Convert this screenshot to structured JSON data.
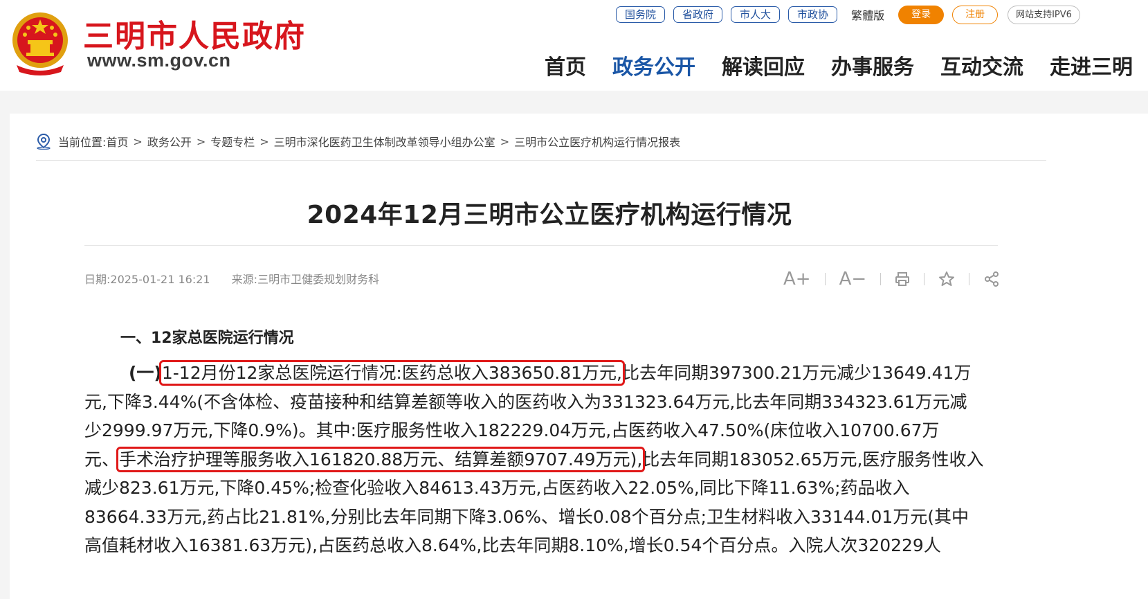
{
  "header": {
    "site_name": "三明市人民政府",
    "site_url": "www.sm.gov.cn",
    "top_links": [
      "国务院",
      "省政府",
      "市人大",
      "市政协"
    ],
    "traditional": "繁體版",
    "login": "登录",
    "register": "注册",
    "ipv6": "网站支持IPV6",
    "nav": [
      "首页",
      "政务公开",
      "解读回应",
      "办事服务",
      "互动交流",
      "走进三明"
    ],
    "nav_active": "政务公开"
  },
  "breadcrumb": {
    "prefix": "当前位置:",
    "items": [
      "首页",
      "政务公开",
      "专题专栏",
      "三明市深化医药卫生体制改革领导小组办公室",
      "三明市公立医疗机构运行情况报表"
    ],
    "separator": ">"
  },
  "article": {
    "title": "2024年12月三明市公立医疗机构运行情况",
    "date_label": "日期:2025-01-21 16:21",
    "source_label": "来源:三明市卫健委规划财务科",
    "tools": {
      "font_increase": "A+",
      "font_decrease": "A−",
      "separator": "|"
    },
    "section_heading": "一、12家总医院运行情况",
    "para_label": "(一)",
    "line1_highlight": "1-12月份12家总医院运行情况:医药总收入383650.81万元,",
    "line1_rest": "比去年同期397300.21万元减少13649.41万",
    "line2": "元,下降3.44%(不含体检、疫苗接种和结算差额等收入的医药收入为331323.64万元,比去年同期334323.61万元减",
    "line3": "少2999.97万元,下降0.9%)。其中:医疗服务性收入182229.04万元,占医药收入47.50%(床位收入10700.67万",
    "line4_pre": "元、",
    "line4_highlight": "手术治疗护理等服务收入161820.88万元、结算差额9707.49万元),",
    "line4_rest": "比去年同期183052.65万元,医疗服务性收入",
    "line5": "减少823.61万元,下降0.45%;检查化验收入84613.43万元,占医药收入22.05%,同比下降11.63%;药品收入",
    "line6": "83664.33万元,药占比21.81%,分别比去年同期下降3.06%、增长0.08个百分点;卫生材料收入33144.01万元(其中",
    "line7": "高值耗材收入16381.63万元),占医药总收入8.64%,比去年同期8.10%,增长0.54个百分点。入院人次320229人"
  },
  "colors": {
    "brand_red": "#d7161d",
    "nav_active_blue": "#1a56a6",
    "login_orange": "#f08200",
    "highlight_box": "#e01818"
  }
}
